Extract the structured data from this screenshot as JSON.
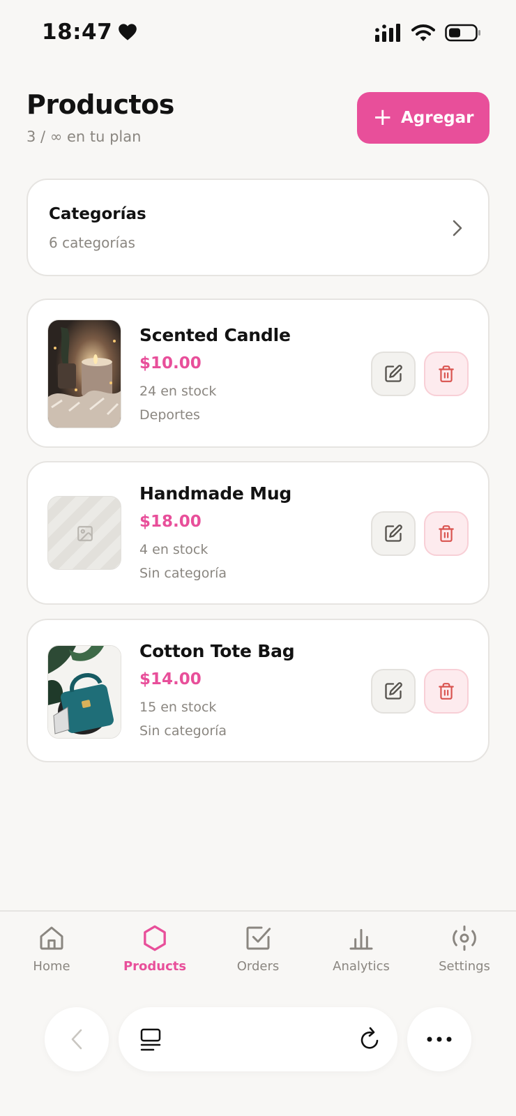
{
  "status_bar": {
    "time": "18:47"
  },
  "header": {
    "title": "Productos",
    "subtitle": "3 / ∞ en tu plan",
    "add_label": "Agregar"
  },
  "categories": {
    "title": "Categorías",
    "count": "6 categorías"
  },
  "products": [
    {
      "name": "Scented Candle",
      "price": "$10.00",
      "stock": "24 en stock",
      "category": "Deportes",
      "image": "candle-photo"
    },
    {
      "name": "Handmade Mug",
      "price": "$18.00",
      "stock": "4 en stock",
      "category": "Sin categoría",
      "image": "placeholder-image-icon"
    },
    {
      "name": "Cotton Tote Bag",
      "price": "$14.00",
      "stock": "15 en stock",
      "category": "Sin categoría",
      "image": "bag-photo"
    }
  ],
  "tabs": [
    {
      "label": "Home",
      "icon": "home-icon",
      "active": false
    },
    {
      "label": "Products",
      "icon": "hexagon-icon",
      "active": true
    },
    {
      "label": "Orders",
      "icon": "checkbox-icon",
      "active": false
    },
    {
      "label": "Analytics",
      "icon": "bar-chart-icon",
      "active": false
    },
    {
      "label": "Settings",
      "icon": "settings-icon",
      "active": false
    }
  ],
  "colors": {
    "accent": "#e84f9a",
    "danger": "#d9534f",
    "muted": "#8a8680",
    "background": "#f8f7f5"
  }
}
